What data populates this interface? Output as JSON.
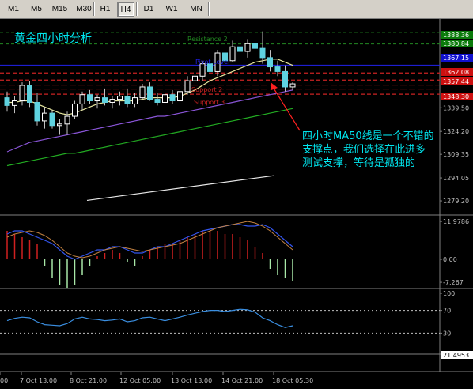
{
  "toolbar": {
    "timeframes": [
      {
        "label": "M1",
        "active": false
      },
      {
        "label": "M5",
        "active": false
      },
      {
        "label": "M15",
        "active": false
      },
      {
        "label": "M30",
        "active": false
      },
      {
        "label": "H1",
        "active": false
      },
      {
        "label": "H4",
        "active": true
      },
      {
        "label": "D1",
        "active": false
      },
      {
        "label": "W1",
        "active": false
      },
      {
        "label": "MN",
        "active": false
      }
    ]
  },
  "chart_title": "黄金四小时分析",
  "annotation": [
    "四小时MA50线是一个不错的",
    "支撑点，我们选择在此进多",
    "测试支撑，等待是孤独的"
  ],
  "level_labels": {
    "resistance2": "Resistance 2",
    "pivot_level": "Pivot Level",
    "support2": "Support 2",
    "support3": "Support 3"
  },
  "colors": {
    "bull_candle": "#ffffff",
    "bear_candle": "#5fd3e0",
    "candle_wick": "#c0c0c0",
    "ma_fast": "#e8e8a0",
    "ma50": "#8a55d8",
    "ma100": "#22aa22",
    "ma200": "#e8e8e8",
    "pivot": "#2222ee",
    "resistance": "#228822",
    "support": "#cc2222",
    "annotation": "#00e5ee",
    "arrow": "#ff2020"
  },
  "price_axis": {
    "ticks": [
      "1339.50",
      "1324.20",
      "1309.35",
      "1294.05",
      "1279.20"
    ],
    "highlighted": [
      {
        "text": "1388.36",
        "color": "#0a7a0a"
      },
      {
        "text": "1380.84",
        "color": "#0a7a0a"
      },
      {
        "text": "1367.15",
        "color": "#1010cc"
      },
      {
        "text": "1362.08",
        "color": "#cc1010"
      },
      {
        "text": "1357.44",
        "color": "#cc1010"
      },
      {
        "text": "1348.30",
        "color": "#cc1010"
      }
    ]
  },
  "macd_axis": {
    "top": "11.9786",
    "mid": "0.00",
    "bottom": "-7.267"
  },
  "rsi_axis": {
    "top": "100",
    "upper": "70",
    "lower": "30",
    "current": "21.4953"
  },
  "time_axis": [
    "00",
    "7 Oct 13:00",
    "8 Oct 21:00",
    "12 Oct 05:00",
    "13 Oct 13:00",
    "14 Oct 21:00",
    "18 Oct 05:30"
  ],
  "candles": [
    {
      "o": 1346,
      "h": 1350,
      "l": 1337,
      "c": 1341
    },
    {
      "o": 1341,
      "h": 1347,
      "l": 1336,
      "c": 1344
    },
    {
      "o": 1344,
      "h": 1356,
      "l": 1341,
      "c": 1354
    },
    {
      "o": 1354,
      "h": 1357,
      "l": 1340,
      "c": 1343
    },
    {
      "o": 1343,
      "h": 1349,
      "l": 1328,
      "c": 1331
    },
    {
      "o": 1331,
      "h": 1340,
      "l": 1326,
      "c": 1336
    },
    {
      "o": 1336,
      "h": 1338,
      "l": 1326,
      "c": 1328
    },
    {
      "o": 1328,
      "h": 1332,
      "l": 1322,
      "c": 1329
    },
    {
      "o": 1329,
      "h": 1337,
      "l": 1322,
      "c": 1334
    },
    {
      "o": 1334,
      "h": 1344,
      "l": 1332,
      "c": 1342
    },
    {
      "o": 1342,
      "h": 1350,
      "l": 1338,
      "c": 1348
    },
    {
      "o": 1348,
      "h": 1351,
      "l": 1342,
      "c": 1344
    },
    {
      "o": 1344,
      "h": 1348,
      "l": 1339,
      "c": 1346
    },
    {
      "o": 1346,
      "h": 1352,
      "l": 1341,
      "c": 1343
    },
    {
      "o": 1343,
      "h": 1347,
      "l": 1339,
      "c": 1345
    },
    {
      "o": 1345,
      "h": 1350,
      "l": 1341,
      "c": 1347
    },
    {
      "o": 1347,
      "h": 1352,
      "l": 1340,
      "c": 1342
    },
    {
      "o": 1342,
      "h": 1349,
      "l": 1340,
      "c": 1346
    },
    {
      "o": 1346,
      "h": 1355,
      "l": 1345,
      "c": 1353
    },
    {
      "o": 1353,
      "h": 1356,
      "l": 1344,
      "c": 1345
    },
    {
      "o": 1345,
      "h": 1349,
      "l": 1341,
      "c": 1343
    },
    {
      "o": 1343,
      "h": 1350,
      "l": 1341,
      "c": 1348
    },
    {
      "o": 1348,
      "h": 1351,
      "l": 1342,
      "c": 1344
    },
    {
      "o": 1344,
      "h": 1353,
      "l": 1343,
      "c": 1350
    },
    {
      "o": 1350,
      "h": 1360,
      "l": 1348,
      "c": 1357
    },
    {
      "o": 1357,
      "h": 1362,
      "l": 1352,
      "c": 1360
    },
    {
      "o": 1360,
      "h": 1370,
      "l": 1357,
      "c": 1368
    },
    {
      "o": 1368,
      "h": 1374,
      "l": 1361,
      "c": 1363
    },
    {
      "o": 1363,
      "h": 1377,
      "l": 1360,
      "c": 1375
    },
    {
      "o": 1375,
      "h": 1380,
      "l": 1366,
      "c": 1370
    },
    {
      "o": 1370,
      "h": 1383,
      "l": 1369,
      "c": 1379
    },
    {
      "o": 1379,
      "h": 1384,
      "l": 1373,
      "c": 1376
    },
    {
      "o": 1376,
      "h": 1384,
      "l": 1372,
      "c": 1381
    },
    {
      "o": 1381,
      "h": 1385,
      "l": 1375,
      "c": 1378
    },
    {
      "o": 1378,
      "h": 1389,
      "l": 1368,
      "c": 1372
    },
    {
      "o": 1372,
      "h": 1377,
      "l": 1363,
      "c": 1366
    },
    {
      "o": 1366,
      "h": 1370,
      "l": 1360,
      "c": 1363
    },
    {
      "o": 1363,
      "h": 1367,
      "l": 1350,
      "c": 1353
    },
    {
      "o": 1353,
      "h": 1356,
      "l": 1351,
      "c": 1355
    }
  ],
  "ma_fast": [
    1343,
    1343,
    1344,
    1344,
    1342,
    1340,
    1338,
    1336,
    1335,
    1336,
    1338,
    1340,
    1342,
    1343,
    1344,
    1344,
    1344,
    1344,
    1345,
    1346,
    1346,
    1346,
    1346,
    1347,
    1349,
    1351,
    1354,
    1357,
    1359,
    1361,
    1363,
    1365,
    1367,
    1369,
    1370,
    1371,
    1371,
    1369,
    1367
  ],
  "ma50": [
    1311,
    1313,
    1315,
    1317,
    1318,
    1319,
    1320,
    1321,
    1322,
    1323,
    1324,
    1325,
    1326,
    1327,
    1328,
    1329,
    1330,
    1331,
    1332,
    1333,
    1334,
    1334,
    1335,
    1336,
    1337,
    1338,
    1339,
    1340,
    1341,
    1342,
    1343,
    1344,
    1345,
    1346,
    1347,
    1348,
    1349,
    1350,
    1351
  ],
  "ma100": [
    1302,
    1303,
    1304,
    1305,
    1306,
    1307,
    1308,
    1309,
    1310,
    1310,
    1311,
    1312,
    1313,
    1314,
    1315,
    1316,
    1317,
    1318,
    1319,
    1320,
    1321,
    1322,
    1323,
    1324,
    1325,
    1326,
    1327,
    1328,
    1329,
    1330,
    1331,
    1332,
    1333,
    1334,
    1335,
    1336,
    1337,
    1338,
    1339
  ],
  "ma200_start": {
    "price": 1279.5
  },
  "ma200_end": {
    "price": 1295.5
  },
  "levels": {
    "resistance": [
      1388.36,
      1380.84
    ],
    "pivot": 1367.15,
    "support": [
      1362.08,
      1357.44,
      1348.3
    ]
  },
  "macd": {
    "hist": [
      9,
      8,
      7,
      6,
      5,
      -2,
      -6,
      -8,
      -9,
      -8,
      -5,
      -2,
      1,
      2,
      3,
      2,
      -1,
      -2,
      1,
      3,
      4,
      5,
      5,
      6,
      7,
      8,
      9,
      9,
      9,
      8,
      8,
      7,
      6,
      4,
      2,
      -3,
      -5,
      -6,
      -7
    ],
    "main": [
      8,
      9,
      9,
      8,
      7,
      6,
      5,
      3,
      1,
      0,
      1,
      2,
      3,
      3,
      4,
      4,
      3,
      2,
      2,
      3,
      4,
      4,
      5,
      6,
      7,
      8,
      9,
      9.5,
      10,
      10.5,
      11,
      11,
      10.5,
      10.5,
      11,
      10,
      8,
      6,
      4
    ],
    "signal": [
      7,
      8,
      8.5,
      9,
      8.5,
      7.5,
      6,
      4,
      2,
      1,
      0.5,
      1,
      2,
      3,
      3.5,
      4,
      3.5,
      3,
      2.5,
      3,
      3.5,
      4,
      4.5,
      5,
      6,
      7,
      8,
      9,
      10,
      10.5,
      11,
      11.5,
      12,
      11.5,
      10.5,
      9,
      7,
      5,
      3
    ]
  },
  "rsi": [
    52,
    56,
    58,
    57,
    50,
    45,
    44,
    43,
    47,
    55,
    58,
    55,
    54,
    52,
    53,
    55,
    50,
    52,
    57,
    58,
    55,
    52,
    55,
    58,
    62,
    65,
    68,
    70,
    70,
    68,
    70,
    72,
    71,
    67,
    57,
    52,
    45,
    40,
    43
  ]
}
